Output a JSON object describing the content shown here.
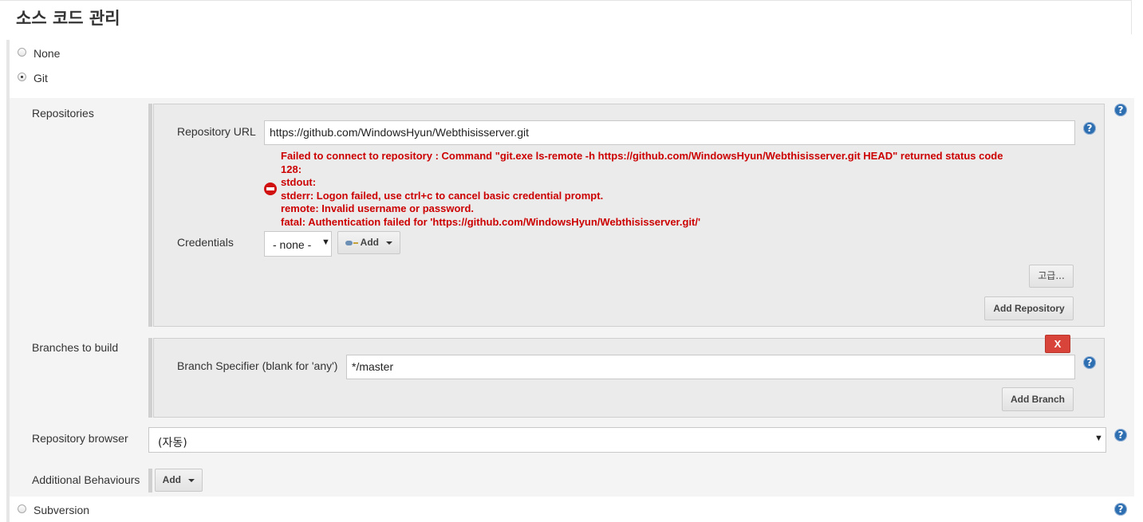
{
  "section": {
    "title": "소스 코드 관리"
  },
  "scm_options": [
    {
      "label": "None",
      "checked": false
    },
    {
      "label": "Git",
      "checked": true
    },
    {
      "label": "Subversion",
      "checked": false
    }
  ],
  "repositories": {
    "label": "Repositories",
    "url_label": "Repository URL",
    "url_value": "https://github.com/WindowsHyun/Webthisisserver.git",
    "error_lines": [
      "Failed to connect to repository : Command \"git.exe ls-remote -h https://github.com/WindowsHyun/Webthisisserver.git HEAD\" returned status code",
      "128:",
      "stdout:",
      "stderr: Logon failed, use ctrl+c to cancel basic credential prompt.",
      "remote: Invalid username or password.",
      "fatal: Authentication failed for 'https://github.com/WindowsHyun/Webthisisserver.git/'"
    ],
    "credentials_label": "Credentials",
    "credentials_value": "- none -",
    "add_label": "Add",
    "advanced_label": "고급...",
    "add_repository_label": "Add Repository"
  },
  "branches": {
    "label": "Branches to build",
    "delete_label": "X",
    "specifier_label": "Branch Specifier (blank for 'any')",
    "specifier_value": "*/master",
    "add_branch_label": "Add Branch"
  },
  "repo_browser": {
    "label": "Repository browser",
    "value": "(자동)"
  },
  "additional": {
    "label": "Additional Behaviours",
    "add_label": "Add"
  },
  "help_glyph": "?",
  "colors": {
    "error": "#cc0000",
    "help": "#2e6fb2",
    "delete": "#d9443a"
  }
}
